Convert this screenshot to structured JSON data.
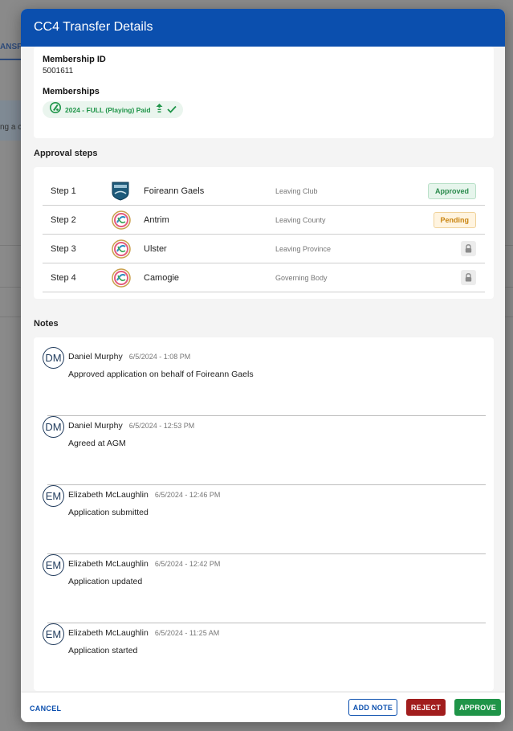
{
  "background": {
    "tab_fragment": "ANSF",
    "band_fragment": "ng a c"
  },
  "modal": {
    "title": "CC4 Transfer Details"
  },
  "membership": {
    "id_label": "Membership ID",
    "id_value": "5001611",
    "memberships_label": "Memberships",
    "chip_text": "2024 - FULL (Playing) Paid"
  },
  "approval": {
    "title": "Approval steps",
    "steps": [
      {
        "step": "Step 1",
        "org": "Foireann Gaels",
        "type": "Leaving Club",
        "status": "Approved",
        "logo": "club-crest-icon"
      },
      {
        "step": "Step 2",
        "org": "Antrim",
        "type": "Leaving County",
        "status": "Pending",
        "logo": "camogie-logo-icon"
      },
      {
        "step": "Step 3",
        "org": "Ulster",
        "type": "Leaving Province",
        "status": "locked",
        "logo": "camogie-logo-icon"
      },
      {
        "step": "Step 4",
        "org": "Camogie",
        "type": "Governing Body",
        "status": "locked",
        "logo": "camogie-logo-icon"
      }
    ]
  },
  "notes": {
    "title": "Notes",
    "items": [
      {
        "initials": "DM",
        "author": "Daniel Murphy",
        "time": "6/5/2024 - 1:08 PM",
        "text": "Approved application on behalf of Foireann Gaels"
      },
      {
        "initials": "DM",
        "author": "Daniel Murphy",
        "time": "6/5/2024 - 12:53 PM",
        "text": "Agreed at AGM"
      },
      {
        "initials": "EM",
        "author": "Elizabeth McLaughlin",
        "time": "6/5/2024 - 12:46 PM",
        "text": "Application submitted"
      },
      {
        "initials": "EM",
        "author": "Elizabeth McLaughlin",
        "time": "6/5/2024 - 12:42 PM",
        "text": "Application updated"
      },
      {
        "initials": "EM",
        "author": "Elizabeth McLaughlin",
        "time": "6/5/2024 - 11:25 AM",
        "text": "Application started"
      }
    ]
  },
  "footer": {
    "cancel": "CANCEL",
    "add_note": "ADD NOTE",
    "reject": "REJECT",
    "approve": "APPROVE"
  },
  "colors": {
    "header": "#0b4fae",
    "approved": "#2a8a4c",
    "pending": "#c98410",
    "reject": "#a11d1d",
    "approve": "#1f9448"
  }
}
